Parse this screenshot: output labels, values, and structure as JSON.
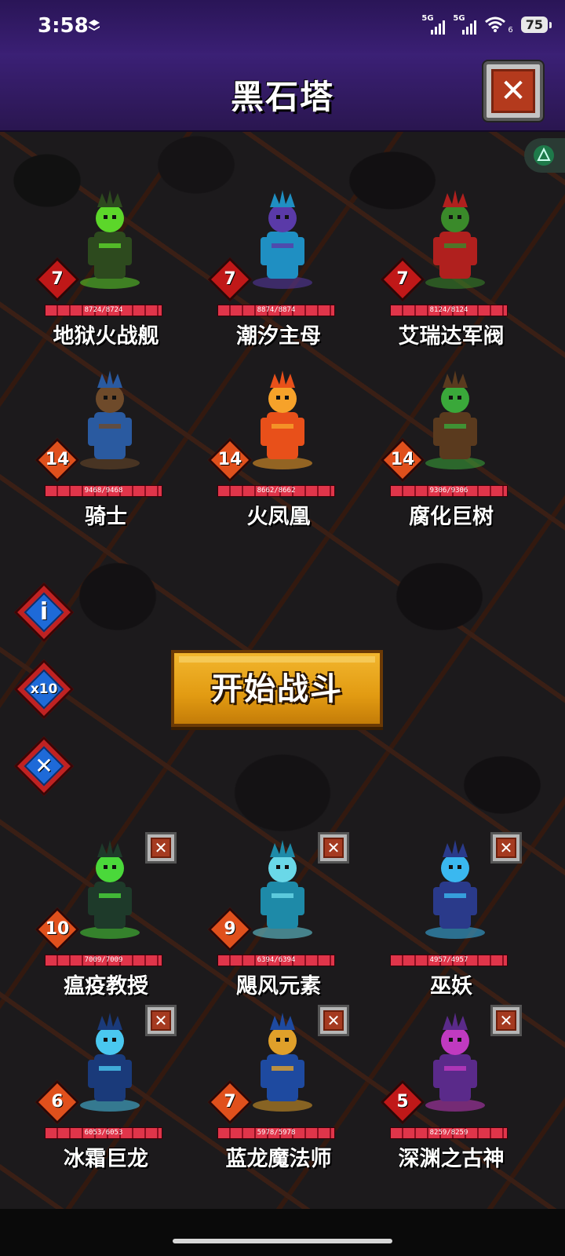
{
  "status_bar": {
    "time": "3:58",
    "signal1_label": "5G",
    "signal2_label": "5G",
    "signal2_sub": "6",
    "battery": "75"
  },
  "header": {
    "title": "黑石塔",
    "close_icon": "close-icon"
  },
  "enemy_units": [
    {
      "name": "地狱火战舰",
      "level": "7",
      "hp_text": "8724/8724",
      "hp": 1.0,
      "icon": "hellfire-warship-icon",
      "colors": [
        "#2d4a1e",
        "#5cd62a"
      ]
    },
    {
      "name": "潮汐主母",
      "level": "7",
      "hp_text": "8874/8874",
      "hp": 1.0,
      "icon": "tidal-matriarch-icon",
      "colors": [
        "#1f8fc2",
        "#5a3aa8"
      ]
    },
    {
      "name": "艾瑞达军阀",
      "level": "7",
      "hp_text": "8124/8124",
      "hp": 1.0,
      "icon": "eredar-warlord-icon",
      "colors": [
        "#b0201e",
        "#3a8a2a"
      ]
    },
    {
      "name": "骑士",
      "level": "14",
      "hp_text": "9468/9468",
      "hp": 1.0,
      "icon": "knight-icon",
      "colors": [
        "#2a5aa0",
        "#6e4a2a"
      ]
    },
    {
      "name": "火凤凰",
      "level": "14",
      "hp_text": "8662/8662",
      "hp": 1.0,
      "icon": "phoenix-icon",
      "colors": [
        "#e8501a",
        "#f6a22a"
      ]
    },
    {
      "name": "腐化巨树",
      "level": "14",
      "hp_text": "9306/9306",
      "hp": 1.0,
      "icon": "corrupted-treant-icon",
      "colors": [
        "#5a3a1e",
        "#3aa83a"
      ]
    }
  ],
  "player_units": [
    {
      "name": "瘟疫教授",
      "level": "10",
      "hp_text": "7009/7009",
      "hp": 1.0,
      "icon": "plague-professor-icon",
      "colors": [
        "#1e3a2a",
        "#4ad83a"
      ]
    },
    {
      "name": "飓风元素",
      "level": "9",
      "hp_text": "6394/6394",
      "hp": 1.0,
      "icon": "hurricane-elemental-icon",
      "colors": [
        "#1e8aa8",
        "#6ad8e8"
      ]
    },
    {
      "name": "巫妖",
      "level": "",
      "hp_text": "4957/4957",
      "hp": 1.0,
      "icon": "lich-icon",
      "colors": [
        "#2a3a8a",
        "#3ab8f0"
      ]
    },
    {
      "name": "冰霜巨龙",
      "level": "6",
      "hp_text": "6053/6053",
      "hp": 1.0,
      "icon": "frost-wyrm-icon",
      "colors": [
        "#1a3a7a",
        "#4ac8f0"
      ]
    },
    {
      "name": "蓝龙魔法师",
      "level": "7",
      "hp_text": "5978/5978",
      "hp": 1.0,
      "icon": "blue-dragon-mage-icon",
      "colors": [
        "#1e4aa0",
        "#e0a02a"
      ]
    },
    {
      "name": "深渊之古神",
      "level": "5",
      "hp_text": "8259/8259",
      "hp": 1.0,
      "icon": "abyssal-old-god-icon",
      "colors": [
        "#5a2a8a",
        "#c03ac0"
      ]
    }
  ],
  "side_buttons": {
    "info": "i",
    "speed": "x10",
    "cancel": "✕"
  },
  "start_button": "开始战斗",
  "colors": {
    "badge_orange": "#e0501c",
    "badge_red": "#c01818",
    "header_purple": "#3b2076",
    "button_gold": "#e29b12"
  }
}
